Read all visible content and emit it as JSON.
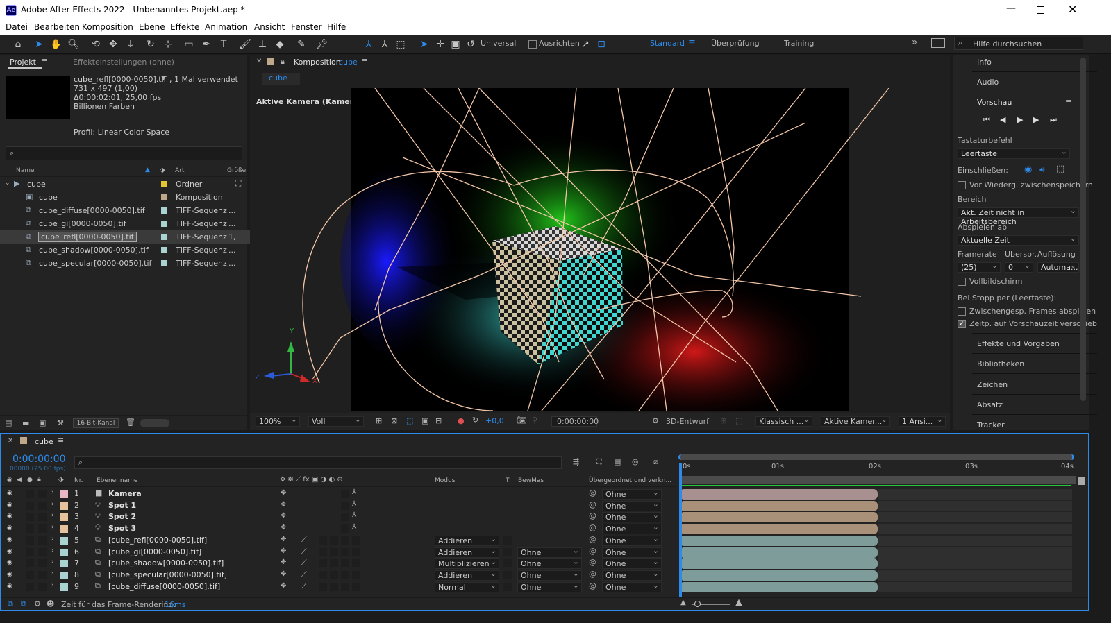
{
  "window": {
    "title": "Adobe After Effects 2022 - Unbenanntes Projekt.aep *",
    "app_icon": "Ae"
  },
  "menu": [
    "Datei",
    "Bearbeiten",
    "Komposition",
    "Ebene",
    "Effekte",
    "Animation",
    "Ansicht",
    "Fenster",
    "Hilfe"
  ],
  "toolbar": {
    "universal": "Universal",
    "ausrichten": "Ausrichten",
    "workspaces": [
      "Standard",
      "Überprüfung",
      "Training"
    ],
    "search_placeholder": "Hilfe durchsuchen"
  },
  "project_panel": {
    "tab_project": "Projekt",
    "tab_effects": "Effekteinstellungen (ohne)",
    "info": {
      "name": "cube_refl[0000-0050].tif",
      "used": ", 1 Mal verwendet",
      "dims": "731 x 497 (1,00)",
      "duration": "Δ0:00:02:01, 25,00 fps",
      "colors": "Billionen Farben",
      "profile": "Profil: Linear Color Space"
    },
    "headers": {
      "name": "Name",
      "type": "Art",
      "size": "Größe"
    },
    "items": [
      {
        "name": "cube",
        "type": "Ordner",
        "color": "#e3c531",
        "size": ""
      },
      {
        "name": "cube",
        "type": "Komposition",
        "color": "#bfa78a",
        "size": ""
      },
      {
        "name": "cube_diffuse[0000-0050].tif",
        "type": "TIFF-Sequenz",
        "color": "#a9d3d0",
        "size": "..."
      },
      {
        "name": "cube_gi[0000-0050].tif",
        "type": "TIFF-Sequenz",
        "color": "#a9d3d0",
        "size": "..."
      },
      {
        "name": "cube_refl[0000-0050].tif",
        "type": "TIFF-Sequenz",
        "color": "#a9d3d0",
        "size": "1,"
      },
      {
        "name": "cube_shadow[0000-0050].tif",
        "type": "TIFF-Sequenz",
        "color": "#a9d3d0",
        "size": "..."
      },
      {
        "name": "cube_specular[0000-0050].tif",
        "type": "TIFF-Sequenz",
        "color": "#a9d3d0",
        "size": "..."
      }
    ],
    "bitdepth": "16-Bit-Kanal"
  },
  "comp_panel": {
    "tab_prefix": "Komposition",
    "tab_name": "cube",
    "sub_tab": "cube",
    "camera_label": "Aktive Kamera (Kamera)",
    "axes": {
      "y": "Y",
      "z": "Z",
      "x": "X"
    },
    "footer": {
      "zoom": "100%",
      "resolution": "Voll",
      "exposure": "+0,0",
      "timecode": "0:00:00:00",
      "renderer": "3D-Entwurf",
      "view_mode": "Klassisch ...",
      "camera": "Aktive Kamer...",
      "views": "1 Ansi..."
    }
  },
  "right_panel": {
    "sections_top": [
      "Info",
      "Audio"
    ],
    "preview": "Vorschau",
    "shortcut_label": "Tastaturbefehl",
    "shortcut_value": "Leertaste",
    "include_label": "Einschließen:",
    "cache_label": "Vor Wiederg. zwischenspeichern",
    "range_label": "Bereich",
    "range_value": "Akt. Zeit nicht in Arbeitsbereich",
    "play_from_label": "Abspielen ab",
    "play_from_value": "Aktuelle Zeit",
    "framerate_label": "Framerate",
    "skip_label": "Überspr.",
    "resolution_label": "Auflösung",
    "framerate_value": "(25)",
    "skip_value": "0",
    "resolution_value": "Automa...",
    "fullscreen_label": "Vollbildschirm",
    "stop_label": "Bei Stopp per (Leertaste):",
    "cached_frames_label": "Zwischengesp. Frames abspielen",
    "time_label": "Zeitp. auf Vorschauzeit verschieb",
    "sections_bottom": [
      "Effekte und Vorgaben",
      "Bibliotheken",
      "Zeichen",
      "Absatz",
      "Tracker"
    ]
  },
  "timeline": {
    "tab": "cube",
    "timecode": "0:00:00:00",
    "fps": "00000 (25.00 fps)",
    "headers": {
      "nr": "Nr.",
      "name": "Ebenenname",
      "mode": "Modus",
      "t": "T",
      "trkmat": "BewMas",
      "parent": "Übergeordnet und verkn..."
    },
    "ruler": [
      "0s",
      "01s",
      "02s",
      "03s",
      "04s"
    ],
    "layers": [
      {
        "nr": "1",
        "name": "Kamera",
        "color": "#e8b6c4",
        "kind": "camera",
        "mode": "",
        "trkmat": "",
        "parent": "Ohne",
        "bar": "#a99090"
      },
      {
        "nr": "2",
        "name": "Spot 1",
        "color": "#e6c29c",
        "kind": "light",
        "mode": "",
        "trkmat": "",
        "parent": "Ohne",
        "bar": "#a99078"
      },
      {
        "nr": "3",
        "name": "Spot 2",
        "color": "#e6c29c",
        "kind": "light",
        "mode": "",
        "trkmat": "",
        "parent": "Ohne",
        "bar": "#a99078"
      },
      {
        "nr": "4",
        "name": "Spot 3",
        "color": "#e6c29c",
        "kind": "light",
        "mode": "",
        "trkmat": "",
        "parent": "Ohne",
        "bar": "#a99078"
      },
      {
        "nr": "5",
        "name": "[cube_refl[0000-0050].tif]",
        "color": "#a9d3d0",
        "kind": "footage",
        "mode": "Addieren",
        "trkmat": "",
        "parent": "Ohne",
        "bar": "#7e9c9a"
      },
      {
        "nr": "6",
        "name": "[cube_gi[0000-0050].tif]",
        "color": "#a9d3d0",
        "kind": "footage",
        "mode": "Addieren",
        "trkmat": "Ohne",
        "parent": "Ohne",
        "bar": "#7e9c9a"
      },
      {
        "nr": "7",
        "name": "[cube_shadow[0000-0050].tif]",
        "color": "#a9d3d0",
        "kind": "footage",
        "mode": "Multiplizieren",
        "trkmat": "Ohne",
        "parent": "Ohne",
        "bar": "#7e9c9a"
      },
      {
        "nr": "8",
        "name": "[cube_specular[0000-0050].tif]",
        "color": "#a9d3d0",
        "kind": "footage",
        "mode": "Addieren",
        "trkmat": "Ohne",
        "parent": "Ohne",
        "bar": "#7e9c9a"
      },
      {
        "nr": "9",
        "name": "[cube_diffuse[0000-0050].tif]",
        "color": "#a9d3d0",
        "kind": "footage",
        "mode": "Normal",
        "trkmat": "Ohne",
        "parent": "Ohne",
        "bar": "#7e9c9a"
      }
    ],
    "status_label": "Zeit für das Frame-Rendering:",
    "status_value": "16ms"
  },
  "colors": {
    "accent": "#2d8ceb",
    "panel": "#232323",
    "bg": "#1b1b1b"
  }
}
